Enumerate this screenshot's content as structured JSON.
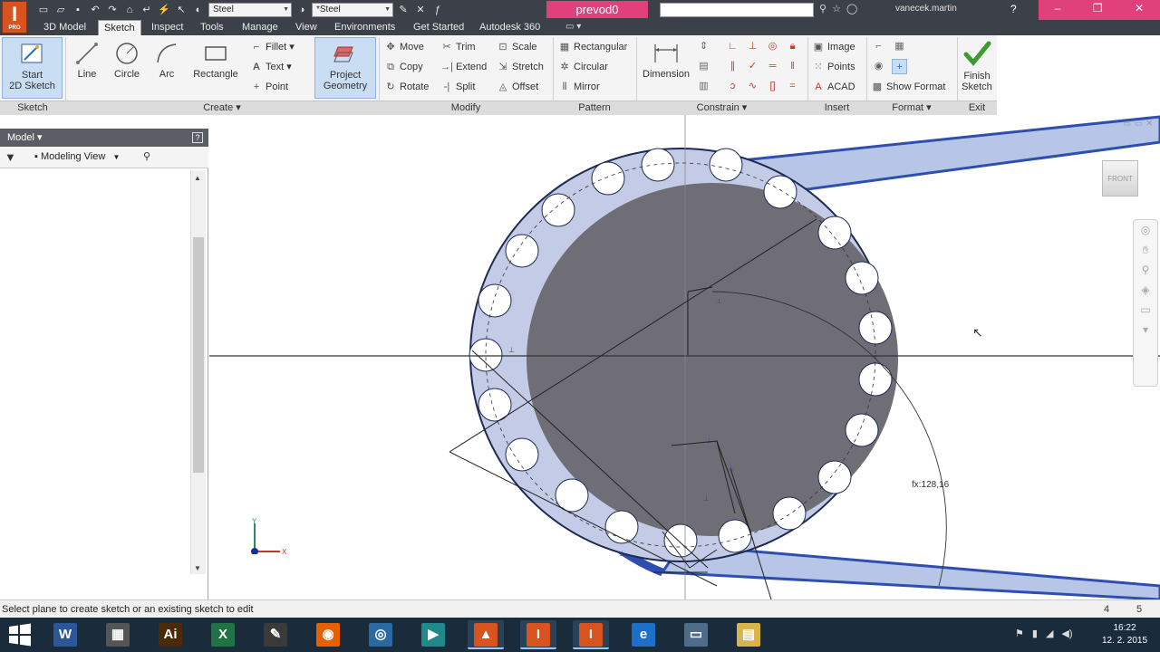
{
  "titlebar": {
    "app_logo": "I",
    "app_logo_sub": "PRO",
    "material": "Steel",
    "appearance": "*Steel",
    "document_title": "prevod0",
    "username": "vanecek.martin"
  },
  "tabs": [
    {
      "label": "3D Model"
    },
    {
      "label": "Sketch"
    },
    {
      "label": "Inspect"
    },
    {
      "label": "Tools"
    },
    {
      "label": "Manage"
    },
    {
      "label": "View"
    },
    {
      "label": "Environments"
    },
    {
      "label": "Get Started"
    },
    {
      "label": "Autodesk 360"
    }
  ],
  "ribbon": {
    "sketch_panel": {
      "start_sketch": "Start\n2D Sketch",
      "panel_label": "Sketch"
    },
    "create_panel": {
      "line": "Line",
      "circle": "Circle",
      "arc": "Arc",
      "rectangle": "Rectangle",
      "fillet": "Fillet",
      "text": "Text",
      "point": "Point",
      "project_geometry": "Project\nGeometry",
      "panel_label": "Create"
    },
    "modify_panel": {
      "move": "Move",
      "copy": "Copy",
      "rotate": "Rotate",
      "trim": "Trim",
      "extend": "Extend",
      "split": "Split",
      "scale": "Scale",
      "stretch": "Stretch",
      "offset": "Offset",
      "panel_label": "Modify"
    },
    "pattern_panel": {
      "rectangular": "Rectangular",
      "circular": "Circular",
      "mirror": "Mirror",
      "panel_label": "Pattern"
    },
    "constrain_panel": {
      "dimension": "Dimension",
      "panel_label": "Constrain"
    },
    "insert_panel": {
      "image": "Image",
      "points": "Points",
      "acad": "ACAD",
      "panel_label": "Insert"
    },
    "format_panel": {
      "show_format": "Show Format",
      "panel_label": "Format"
    },
    "exit_panel": {
      "finish_sketch": "Finish\nSketch",
      "panel_label": "Exit"
    }
  },
  "browser": {
    "title": "Model",
    "view_mode": "Modeling View"
  },
  "canvas": {
    "viewcube_label": "FRONT",
    "dimension_label": "fx:128,16",
    "colors": {
      "belt": "#2f4fb0",
      "belt_fill": "#b7c6e6",
      "sprocket_dark": "#6f6e76",
      "sprocket_light": "#c3cbe6"
    }
  },
  "statusbar": {
    "message": "Select plane to create sketch or an existing sketch to edit",
    "count_left": "4",
    "count_right": "5"
  },
  "taskbar": {
    "apps": [
      {
        "name": "word",
        "glyph": "W",
        "color": "#2b579a"
      },
      {
        "name": "clapper",
        "glyph": "▦",
        "color": "#555"
      },
      {
        "name": "illustrator",
        "glyph": "Ai",
        "color": "#4a2a08"
      },
      {
        "name": "excel",
        "glyph": "X",
        "color": "#217346"
      },
      {
        "name": "app-5",
        "glyph": "✎",
        "color": "#3a3a3a"
      },
      {
        "name": "firefox",
        "glyph": "◉",
        "color": "#e66000"
      },
      {
        "name": "disc",
        "glyph": "◎",
        "color": "#2a6aa0"
      },
      {
        "name": "app-8",
        "glyph": "▶",
        "color": "#1f8a8a"
      },
      {
        "name": "app-9",
        "glyph": "▲",
        "color": "#d9531e"
      },
      {
        "name": "inventor-1",
        "glyph": "I",
        "color": "#d9531e"
      },
      {
        "name": "inventor-2",
        "glyph": "I",
        "color": "#d9531e"
      },
      {
        "name": "ie",
        "glyph": "e",
        "color": "#1e6fc9"
      },
      {
        "name": "app-13",
        "glyph": "▭",
        "color": "#4d6d8a"
      },
      {
        "name": "folder",
        "glyph": "▤",
        "color": "#d9b44a"
      }
    ],
    "time": "16:22",
    "date": "12. 2. 2015"
  }
}
